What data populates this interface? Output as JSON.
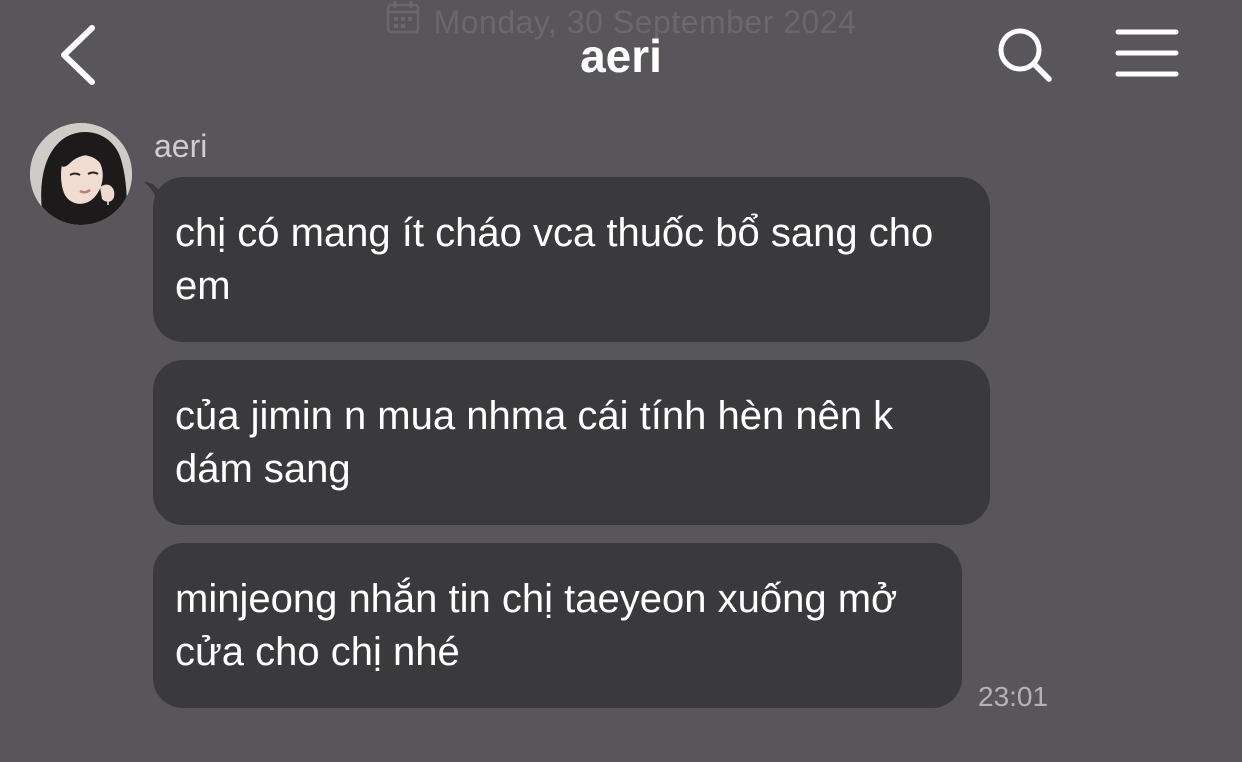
{
  "date_header": "Monday, 30 September 2024",
  "header": {
    "title": "aeri",
    "back_icon": "chevron-left-icon",
    "search_icon": "search-icon",
    "menu_icon": "hamburger-menu-icon"
  },
  "chat": {
    "sender_name": "aeri",
    "messages": [
      {
        "text": "chị có mang ít cháo vca thuốc bổ sang cho em"
      },
      {
        "text": "của jimin n mua nhma cái tính hèn nên k dám sang"
      },
      {
        "text": "minjeong nhắn tin chị taeyeon xuống mở cửa cho chị nhé"
      }
    ],
    "timestamp": "23:01"
  },
  "colors": {
    "background": "#58565a",
    "bubble": "#3a393c",
    "text": "#ffffff",
    "muted_text": "#b4b2b6"
  }
}
